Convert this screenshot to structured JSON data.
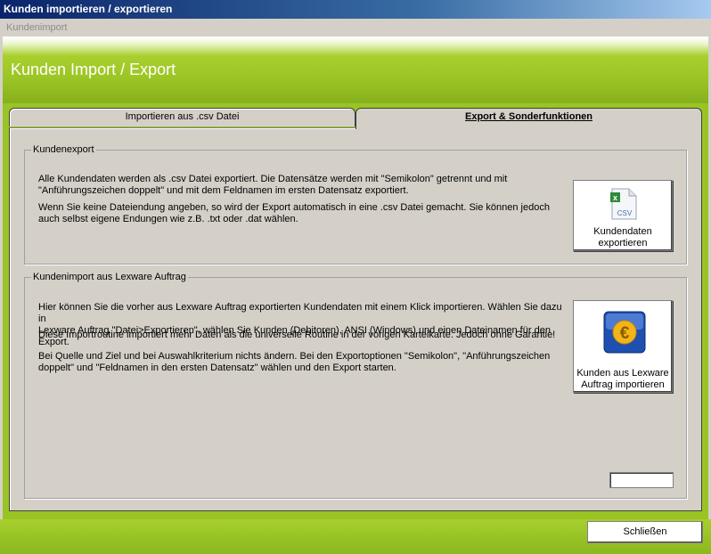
{
  "window": {
    "title": "Kunden importieren / exportieren"
  },
  "menu": {
    "item": "Kundenimport"
  },
  "banner": {
    "title": "Kunden Import / Export"
  },
  "tabs": [
    {
      "label": "Importieren aus .csv Datei"
    },
    {
      "label": "Export & Sonderfunktionen"
    }
  ],
  "export_group": {
    "title": "Kundenexport",
    "para1_line1": "Alle Kundendaten werden als .csv Datei exportiert. Die Datensätze werden mit \"Semikolon\" getrennt und mit",
    "para1_line2": "\"Anführungszeichen doppelt\" und mit dem Feldnamen im ersten Datensatz exportiert.",
    "para2_line1": "Wenn Sie keine Dateiendung angeben, so wird der Export automatisch in eine .csv Datei gemacht. Sie können jedoch",
    "para2_line2": "auch selbst eigene Endungen wie z.B. .txt oder .dat wählen.",
    "button_line1": "Kundendaten",
    "button_line2": "exportieren",
    "icon_text": "CSV"
  },
  "import_group": {
    "title": "Kundenimport aus Lexware Auftrag",
    "para1_line1": "Hier können Sie die vorher aus Lexware Auftrag exportierten Kundendaten mit einem Klick importieren. Wählen Sie dazu in",
    "para1_line2": "Lexware Auftrag \"Datei>Exportieren\", wählen Sie Kunden (Debitoren), ANSI (Windows) und einen Dateinamen für den Export.",
    "para2": "Diese Importroutine importiert mehr Daten als die universelle Routine in der vorigen Karteikarte. Jedoch ohne Garantie!",
    "para3_line1": "Bei Quelle und Ziel und bei Auswahlkriterium nichts ändern.  Bei den Exportoptionen \"Semikolon\", \"Anführungszeichen",
    "para3_line2": "doppelt\" und \"Feldnamen in den ersten Datensatz\" wählen und den Export starten.",
    "button_line1": "Kunden aus Lexware",
    "button_line2": "Auftrag importieren",
    "icon_text": "€"
  },
  "footer": {
    "close_label": "Schließen"
  }
}
